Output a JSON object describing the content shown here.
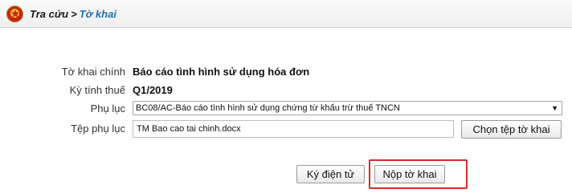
{
  "header": {
    "emblem_icon": "national-emblem-icon",
    "breadcrumb_parent": "Tra cứu",
    "breadcrumb_separator": ">",
    "breadcrumb_current": "Tờ khai"
  },
  "form": {
    "declaration": {
      "label": "Tờ khai chính",
      "value": "Báo cáo tình hình sử dụng hóa đơn"
    },
    "tax_period": {
      "label": "Kỳ tính thuế",
      "value": "Q1/2019"
    },
    "appendix": {
      "label": "Phụ lục",
      "selected": "BC08/AC-Báo cáo tình hình sử dụng chứng từ khấu trừ thuế TNCN",
      "arrow_icon": "dropdown-arrow-icon"
    },
    "appendix_file": {
      "label": "Tệp phụ lục",
      "value": "TM Bao cao tai chinh.docx",
      "choose_button": "Chọn tệp tờ khai"
    }
  },
  "actions": {
    "sign_button": "Ký điện tử",
    "submit_button": "Nộp tờ khai"
  },
  "colors": {
    "accent": "#1a6fb5",
    "highlight": "#d62b2b"
  }
}
